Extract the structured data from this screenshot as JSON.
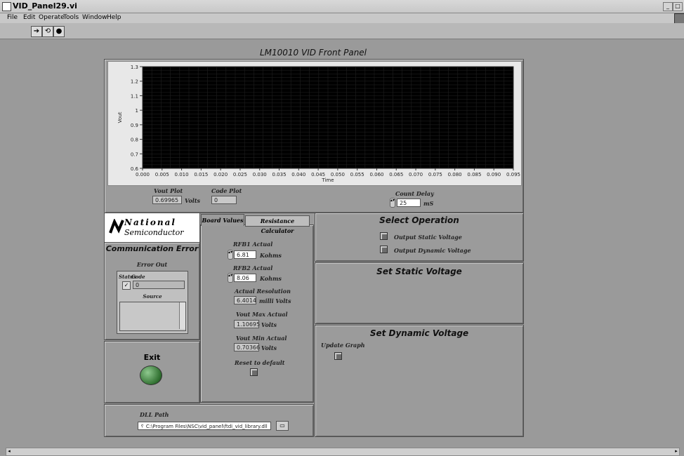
{
  "window": {
    "title": "VID_Panel29.vi"
  },
  "menu": [
    "File",
    "Edit",
    "Operate",
    "Tools",
    "Window",
    "Help"
  ],
  "panel_title": "LM10010 VID Front Panel",
  "graph": {
    "ylabel": "Vout",
    "xlabel": "Time",
    "yticks": [
      "1.3",
      "1.2",
      "1.1",
      "1",
      "0.9",
      "0.8",
      "0.7",
      "0.6"
    ],
    "xticks": [
      "0.000",
      "0.005",
      "0.010",
      "0.015",
      "0.020",
      "0.025",
      "0.030",
      "0.035",
      "0.040",
      "0.045",
      "0.050",
      "0.055",
      "0.060",
      "0.065",
      "0.070",
      "0.075",
      "0.080",
      "0.085",
      "0.090",
      "0.095"
    ],
    "ylim": [
      0.6,
      1.3
    ],
    "xlim": [
      0.0,
      0.095
    ],
    "grid": true,
    "background": "#000000"
  },
  "vout_plot": {
    "label": "Vout Plot",
    "value": "0.69965",
    "unit": "Volts"
  },
  "code_plot": {
    "label": "Code Plot",
    "value": "0"
  },
  "count_delay": {
    "label": "Count Delay",
    "value": "25",
    "unit": "mS"
  },
  "logo": {
    "line1": "National",
    "line2": "Semiconductor"
  },
  "comm": {
    "title": "Communication Error",
    "error_out": "Error Out",
    "status_label": "Status",
    "code_label": "Code",
    "code_value": "0",
    "source_label": "Source"
  },
  "exit_label": "Exit",
  "tabs": {
    "board": "Board Values",
    "resistance": "Resistance Calculator"
  },
  "board": {
    "rfb1_label": "RFB1 Actual",
    "rfb1_value": "6.81",
    "rfb1_unit": "Kohms",
    "rfb2_label": "RFB2 Actual",
    "rfb2_value": "8.06",
    "rfb2_unit": "Kohms",
    "res_label": "Actual Resolution",
    "res_value": "6.4014",
    "res_unit": "milli Volts",
    "vmax_label": "Vout Max Actual",
    "vmax_value": "1.10695",
    "vmax_unit": "Volts",
    "vmin_label": "Vout Min Actual",
    "vmin_value": "0.70366",
    "vmin_unit": "Volts",
    "reset_label": "Reset to default"
  },
  "select_op": {
    "title": "Select Operation",
    "opt1": "Output Static Voltage",
    "opt2": "Output Dynamic Voltage"
  },
  "static_title": "Set Static Voltage",
  "dynamic": {
    "title": "Set Dynamic Voltage",
    "update_label": "Update Graph"
  },
  "dll": {
    "label": "DLL Path",
    "value": "C:\\Program Files\\NSC\\vid_panel\\ftdi_vid_library.dll"
  }
}
